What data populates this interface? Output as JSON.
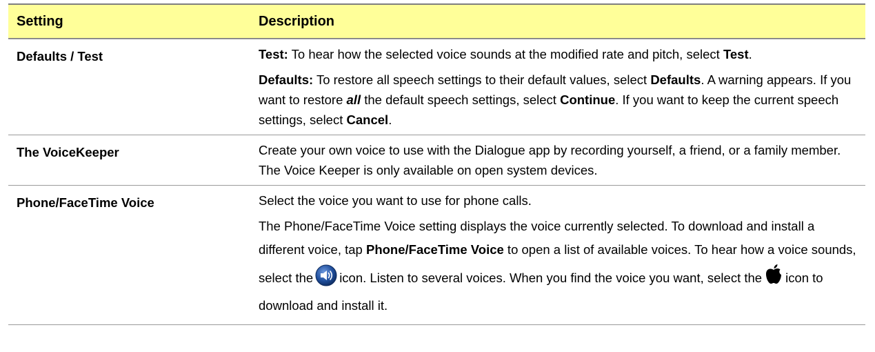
{
  "table": {
    "headers": {
      "setting": "Setting",
      "description": "Description"
    },
    "rows": {
      "defaults": {
        "setting": "Defaults / Test",
        "test": {
          "label": "Test:",
          "text1": " To hear how the selected voice sounds at the modified rate and pitch, select ",
          "bold1": "Test",
          "text2": "."
        },
        "defaults": {
          "label": "Defaults:",
          "text1": " To restore all speech settings to their default values, select ",
          "bold1": "Defaults",
          "text2": ". A warning appears. If you want to restore ",
          "italic1": "all",
          "text3": " the default speech settings, select ",
          "bold2": "Continue",
          "text4": ". If you want to keep the current speech settings, select ",
          "bold3": "Cancel",
          "text5": "."
        }
      },
      "voicekeeper": {
        "setting": "The VoiceKeeper",
        "description": "Create your own voice to use with the Dialogue app by recording yourself, a friend, or a family member. The Voice Keeper is only available on open system devices."
      },
      "phone": {
        "setting": "Phone/FaceTime Voice",
        "p1": "Select the voice you want to use for phone calls.",
        "p2": {
          "text1": "The Phone/FaceTime Voice setting displays the voice currently selected. To download and install a different voice, tap ",
          "bold1": "Phone/FaceTime Voice",
          "text2": " to open a list of available voices. To hear how a voice sounds, select the",
          "text3": "icon. Listen to several voices. When you find the voice you want, select the",
          "text4": "icon to download and install it."
        },
        "icons": {
          "speaker": "speaker-icon",
          "apple": "apple-icon",
          "speaker_color": "#1f4e9c"
        }
      }
    },
    "colors": {
      "header_bg": "#ffff99",
      "border": "#9a9a9a"
    }
  }
}
